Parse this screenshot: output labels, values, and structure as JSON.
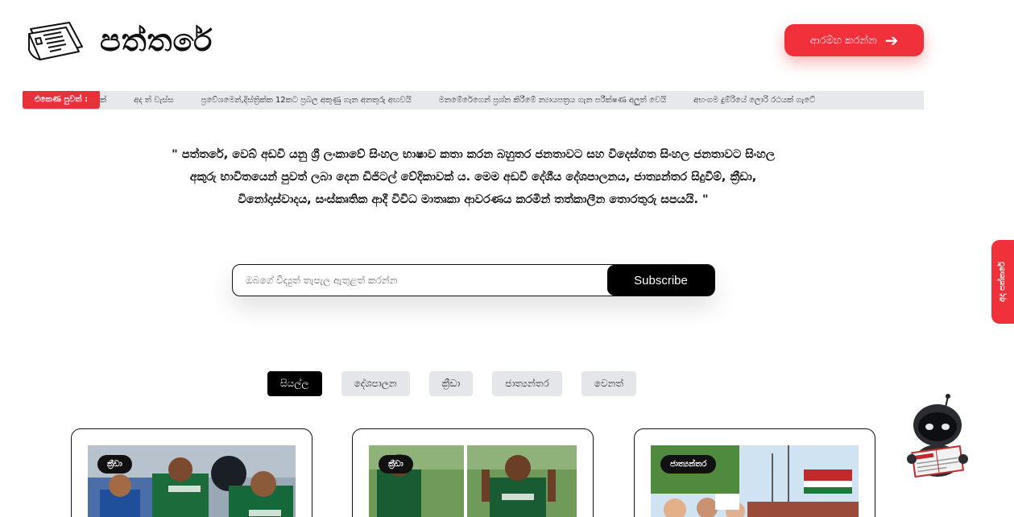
{
  "brand": {
    "name": "පත්තරේ",
    "logo_icon": "newspaper-icon"
  },
  "header": {
    "cta_label": "ආරම්භ කරන්න",
    "cta_icon": "arrow-right-icon"
  },
  "ticker": {
    "label": "එකෙණ පුවත් :",
    "items": [
      "ක්",
      "අද ත් වැස්ස",
      "ප්‍රවේශමෙන්,දිස්ත්‍රික්ක 12කට ප්‍රබල අකුණු ගැන අනතුරු අඟවයි",
      "මනමේරේගෙන් ප්‍රශ්න කිරීමේ න්‍යායපත්‍රය ගැන පරීක්ෂණ අලුත් වෙයි",
      "අභංගම දුම්රියේ ලොරි රථයක් ගැටේ"
    ]
  },
  "intro": {
    "text": "\" පත්තරේ, වෙබ් අඩවි යනු ශ්‍රී ලංකාවේ සිංහල භාෂාව කතා කරන බහුතර ජනතාවට සහ විදෙස්ගත සිංහල ජනතාවට සිංහල අකුරු භාවිතයෙන් පුවත් ලබා දෙන ඩිජිටල් වේදිකාවක් ය. මෙම අඩවි දේශීය දේශපාලනය, ජාත්‍යන්තර සිදුවීම්, ක්‍රීඩා, විනෝදාස්වාදය, සංස්කෘතික ආදී විවිධ මාතෘකා ආවරණය කරමින් තත්කාලීන තොරතුරු සපයයි. \""
  },
  "subscribe": {
    "placeholder": "ඔබගේ විද්‍යුත් තැපැල ඇතුළත් කරන්න",
    "button_label": "Subscribe"
  },
  "side_tab": {
    "label": "අද පත්තරේ"
  },
  "filters": {
    "active_index": 0,
    "items": [
      "සියල්ල",
      "දේශපාලන",
      "ක්‍රීඩා",
      "ජාත්‍යන්තර",
      "වෙනත්"
    ]
  },
  "cards": [
    {
      "badge": "ක්‍රීඩා"
    },
    {
      "badge": "ක්‍රීඩා"
    },
    {
      "badge": "ජාත්‍යන්තර"
    }
  ],
  "colors": {
    "accent": "#f0303a",
    "dark": "#000000",
    "filter_bg": "#e5e6ea",
    "ticker_bg": "#e7e8ec"
  },
  "assistant": {
    "icon": "robot-reading-newspaper-icon"
  }
}
